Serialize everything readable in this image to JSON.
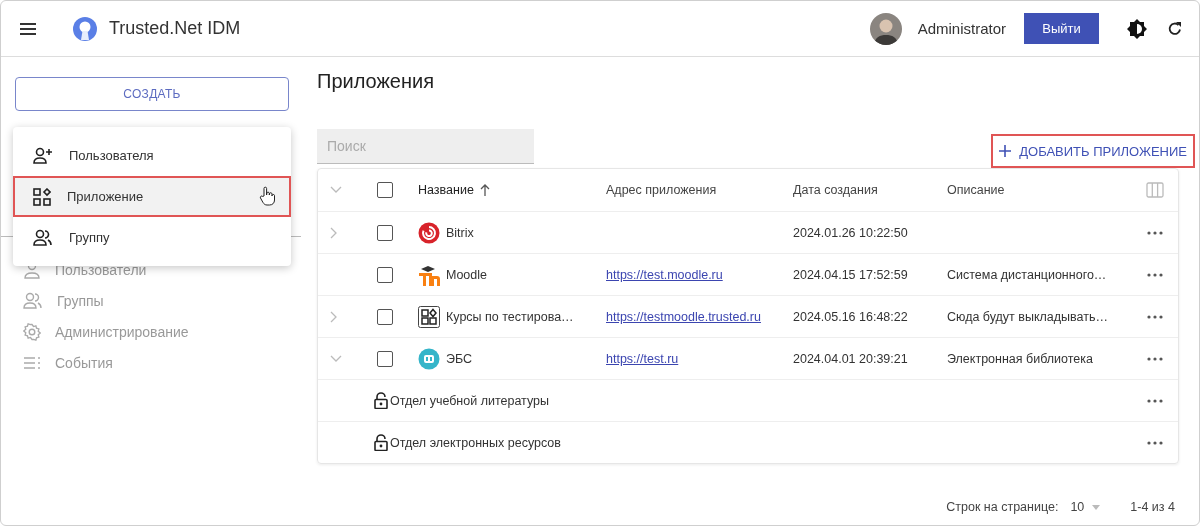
{
  "header": {
    "app_name": "Trusted.Net IDM",
    "user": "Administrator",
    "logout": "Выйти"
  },
  "sidebar": {
    "create_button": "СОЗДАТЬ",
    "items": [
      {
        "label": "Пользователи"
      },
      {
        "label": "Группы"
      },
      {
        "label": "Администрирование"
      },
      {
        "label": "События"
      }
    ]
  },
  "create_menu": [
    {
      "label": "Пользователя",
      "selected": false
    },
    {
      "label": "Приложение",
      "selected": true
    },
    {
      "label": "Группу",
      "selected": false
    }
  ],
  "page": {
    "title": "Приложения",
    "search": {
      "placeholder": "Поиск"
    },
    "add_button": {
      "label": "ДОБАВИТЬ ПРИЛОЖЕНИЕ",
      "highlighted": true
    }
  },
  "table": {
    "all_checked": false,
    "columns": [
      {
        "label": "Название",
        "sorted": true
      },
      {
        "label": "Адрес приложения",
        "sorted": false
      },
      {
        "label": "Дата создания",
        "sorted": false
      },
      {
        "label": "Описание",
        "sorted": false
      }
    ],
    "rows": [
      {
        "name": "Bitrix",
        "expanded": false,
        "checked": false,
        "date": "2024.01.26 10:22:50"
      },
      {
        "name": "Moodle",
        "checked": false,
        "url": "https://test.moodle.ru",
        "date": "2024.04.15 17:52:59",
        "description": "Система дистанционного…"
      },
      {
        "name": "Курсы по тестирова…",
        "expanded": false,
        "checked": false,
        "url": "https://testmoodle.trusted.ru",
        "date": "2024.05.16 16:48:22",
        "description": "Сюда будут выкладывать…"
      },
      {
        "name": "ЭБС",
        "expanded": true,
        "checked": false,
        "url": "https://test.ru",
        "date": "2024.04.01 20:39:21",
        "description": "Электронная библиотека",
        "children": [
          {
            "name": "Отдел учебной литературы"
          },
          {
            "name": "Отдел электронных ресурсов"
          }
        ]
      }
    ]
  },
  "footer": {
    "rows_per_page_label": "Строк на странице:",
    "rows_per_page": "10",
    "range": "1-4 из 4"
  }
}
